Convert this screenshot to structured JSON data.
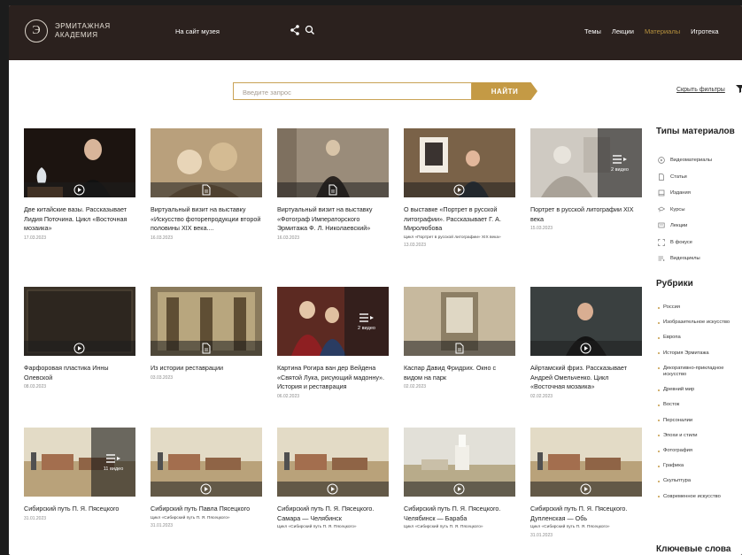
{
  "header": {
    "logo_letter": "Э",
    "logo_line1": "ЭРМИТАЖНАЯ",
    "logo_line2": "АКАДЕМИЯ",
    "museum_link": "На сайт музея",
    "nav": [
      "Темы",
      "Лекции",
      "Материалы",
      "Игротека"
    ],
    "active_nav": "Материалы",
    "accent_color": "#c49a45"
  },
  "search": {
    "placeholder": "Введите запрос",
    "button": "НАЙТИ",
    "hide_filters": "Скрыть фильтры"
  },
  "cards": [
    {
      "title": "Две китайские вазы. Рассказывает Лидия Поточина. Цикл «Восточная мозаика»",
      "cycle": "",
      "date": "17.03.2023",
      "icon": "play-icon",
      "overlay": null,
      "theme": "dark-portrait"
    },
    {
      "title": "Виртуальный визит на выставку «Искусство фоторепродукции второй половины XIX века....",
      "cycle": "",
      "date": "16.03.2023",
      "icon": "document-icon",
      "overlay": null,
      "theme": "sepia"
    },
    {
      "title": "Виртуальный визит на выставку «Фотограф Императорского Эрмитажа Ф. Л. Николаевский»",
      "cycle": "",
      "date": "16.03.2023",
      "icon": "document-icon",
      "overlay": null,
      "theme": "sepia-portrait"
    },
    {
      "title": "О выставке «Портрет в русской литографии». Рассказывает Г. А. Миролюбова",
      "cycle": "Цикл «Портрет в русской литографии» XIX века»",
      "date": "13.03.2023",
      "icon": "play-icon",
      "overlay": null,
      "theme": "room"
    },
    {
      "title": "Портрет в русской литографии XIX века",
      "cycle": "",
      "date": "15.03.2023",
      "icon": "",
      "overlay": "2 видео",
      "theme": "sketch"
    },
    {
      "title": "Фарфоровая пластика Инны Олевской",
      "cycle": "",
      "date": "08.03.2023",
      "icon": "play-icon",
      "overlay": null,
      "theme": "dark-title"
    },
    {
      "title": "Из истории реставрации",
      "cycle": "",
      "date": "03.03.2023",
      "icon": "document-icon",
      "overlay": null,
      "theme": "hall"
    },
    {
      "title": "Картина Рогира ван дер Вейдена «Святой Лука, рисующий мадонну». История и реставрация",
      "cycle": "",
      "date": "06.02.2023",
      "icon": "",
      "overlay": "2 видео",
      "theme": "painting"
    },
    {
      "title": "Каспар Давид Фридрих. Окно с видом на парк",
      "cycle": "",
      "date": "02.02.2023",
      "icon": "document-icon",
      "overlay": null,
      "theme": "window"
    },
    {
      "title": "Айртамский фриз. Рассказывает Андрей Омельченко. Цикл «Восточная мозаика»",
      "cycle": "",
      "date": "02.02.2023",
      "icon": "play-icon",
      "overlay": null,
      "theme": "dark-portrait2"
    },
    {
      "title": "Сибирский путь П. Я. Пясецкого",
      "cycle": "",
      "date": "31.01.2023",
      "icon": "",
      "overlay": "11 видео",
      "theme": "landscape"
    },
    {
      "title": "Сибирский путь Павла Пясецкого",
      "cycle": "Цикл «Сибирский путь П. Я. Пясецкого»",
      "date": "31.01.2023",
      "icon": "play-icon",
      "overlay": null,
      "theme": "landscape"
    },
    {
      "title": "Сибирский путь П. Я. Пясецкого. Самара — Челябинск",
      "cycle": "Цикл «Сибирский путь П. Я. Пясецкого»",
      "date": "",
      "icon": "play-icon",
      "overlay": null,
      "theme": "landscape"
    },
    {
      "title": "Сибирский путь П. Я. Пясецкого. Челябинск — Бараба",
      "cycle": "Цикл «Сибирский путь П. Я. Пясецкого»",
      "date": "",
      "icon": "play-icon",
      "overlay": null,
      "theme": "landscape-church"
    },
    {
      "title": "Сибирский путь П. Я. Пясецкого. Дупленская — Обь",
      "cycle": "Цикл «Сибирский путь П. Я. Пясецкого»",
      "date": "31.01.2023",
      "icon": "play-icon",
      "overlay": null,
      "theme": "landscape"
    }
  ],
  "sidebar": {
    "types_title": "Типы материалов",
    "types": [
      {
        "label": "Видеоматериалы",
        "icon": "play-icon"
      },
      {
        "label": "Статьи",
        "icon": "document-icon"
      },
      {
        "label": "Издания",
        "icon": "book-icon"
      },
      {
        "label": "Курсы",
        "icon": "mortarboard-icon"
      },
      {
        "label": "Лекции",
        "icon": "lecture-icon"
      },
      {
        "label": "В фокусе",
        "icon": "focus-icon"
      },
      {
        "label": "Видеоциклы",
        "icon": "list-icon"
      }
    ],
    "rubrics_title": "Рубрики",
    "rubrics": [
      "Россия",
      "Изобразительное искусство",
      "Европа",
      "История Эрмитажа",
      "Декоративно-прикладное искусство",
      "Древний мир",
      "Восток",
      "Персоналии",
      "Эпохи и стили",
      "Фотография",
      "Графика",
      "Скульптура",
      "Современное искусство"
    ],
    "keywords_title": "Ключевые слова"
  }
}
